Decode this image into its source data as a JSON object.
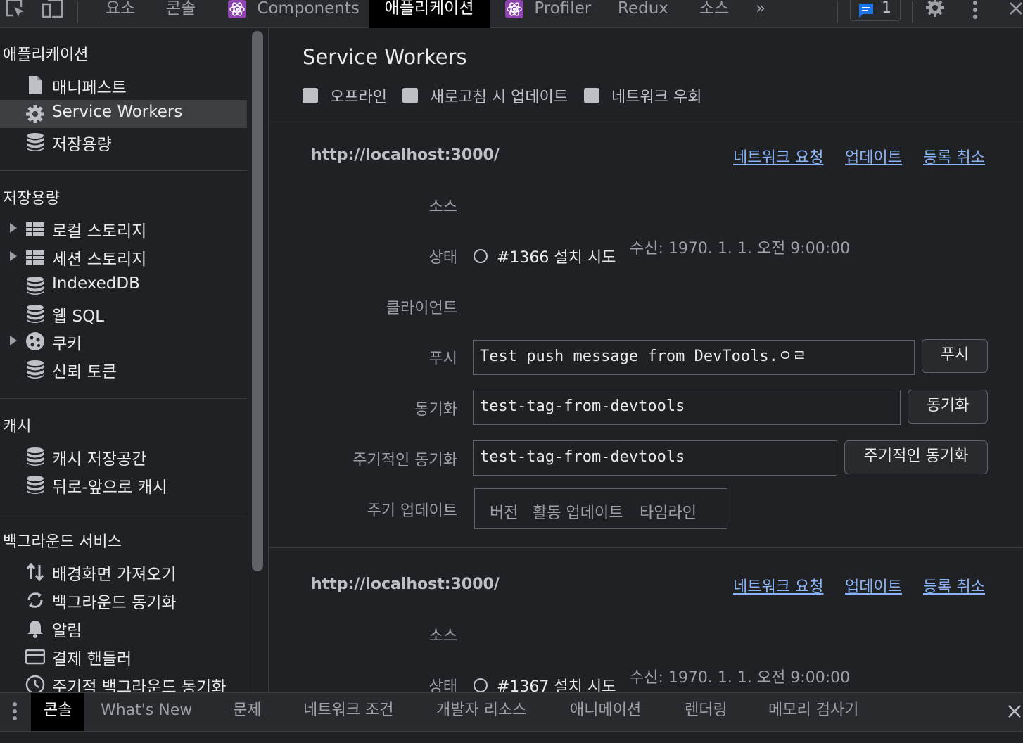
{
  "toolbar": {
    "tabs": [
      {
        "label": "요소"
      },
      {
        "label": "콘솔"
      },
      {
        "label": "Components"
      },
      {
        "label": "애플리케이션"
      },
      {
        "label": "Profiler"
      },
      {
        "label": "Redux"
      },
      {
        "label": "소스"
      }
    ],
    "more": "»",
    "message_count": "1"
  },
  "sidebar": {
    "sections": {
      "application": "애플리케이션",
      "storage": "저장용량",
      "cache": "캐시",
      "background": "백그라운드 서비스"
    },
    "application_items": [
      {
        "label": "매니페스트",
        "icon": "file-icon"
      },
      {
        "label": "Service Workers",
        "icon": "gear-icon"
      },
      {
        "label": "저장용량",
        "icon": "database-icon"
      }
    ],
    "storage_items": [
      {
        "label": "로컬 스토리지",
        "icon": "table-icon"
      },
      {
        "label": "세션 스토리지",
        "icon": "table-icon"
      },
      {
        "label": "IndexedDB",
        "icon": "database-icon"
      },
      {
        "label": "웹 SQL",
        "icon": "database-icon"
      },
      {
        "label": "쿠키",
        "icon": "cookie-icon"
      },
      {
        "label": "신뢰 토큰",
        "icon": "database-icon"
      }
    ],
    "cache_items": [
      {
        "label": "캐시 저장공간",
        "icon": "database-icon"
      },
      {
        "label": "뒤로-앞으로 캐시",
        "icon": "database-icon"
      }
    ],
    "background_items": [
      {
        "label": "배경화면 가져오기",
        "icon": "fetch-arrows-icon"
      },
      {
        "label": "백그라운드 동기화",
        "icon": "sync-icon"
      },
      {
        "label": "알림",
        "icon": "bell-icon"
      },
      {
        "label": "결제 핸들러",
        "icon": "card-icon"
      },
      {
        "label": "주기적 백그라운드 동기화",
        "icon": "clock-icon"
      }
    ]
  },
  "main": {
    "title": "Service Workers",
    "options": [
      {
        "label": "오프라인"
      },
      {
        "label": "새로고침 시 업데이트"
      },
      {
        "label": "네트워크 우회"
      }
    ],
    "workers": [
      {
        "url": "http://localhost:3000/",
        "actions": [
          "네트워크 요청",
          "업데이트",
          "등록 취소"
        ],
        "source_label": "소스",
        "status_label": "상태",
        "status_text": "#1366 설치 시도",
        "received": "수신: 1970. 1. 1. 오전 9:00:00",
        "clients_label": "클라이언트",
        "push_label": "푸시",
        "push_value": "Test push message from DevTools.ㅇㄹ",
        "push_button": "푸시",
        "sync_label": "동기화",
        "sync_value": "test-tag-from-devtools",
        "sync_button": "동기화",
        "periodic_label": "주기적인 동기화",
        "periodic_value": "test-tag-from-devtools",
        "periodic_button": "주기적인 동기화",
        "update_cycle_label": "주기 업데이트",
        "update_cycle_headers": [
          "버전",
          "활동 업데이트",
          "타임라인"
        ]
      },
      {
        "url": "http://localhost:3000/",
        "actions": [
          "네트워크 요청",
          "업데이트",
          "등록 취소"
        ],
        "source_label": "소스",
        "status_label": "상태",
        "status_text": "#1367 설치 시도",
        "received": "수신: 1970. 1. 1. 오전 9:00:00"
      }
    ]
  },
  "drawer": {
    "tabs": [
      {
        "label": "콘솔"
      },
      {
        "label": "What's New"
      },
      {
        "label": "문제"
      },
      {
        "label": "네트워크 조건"
      },
      {
        "label": "개발자 리소스"
      },
      {
        "label": "애니메이션"
      },
      {
        "label": "렌더링"
      },
      {
        "label": "메모리 검사기"
      }
    ]
  }
}
